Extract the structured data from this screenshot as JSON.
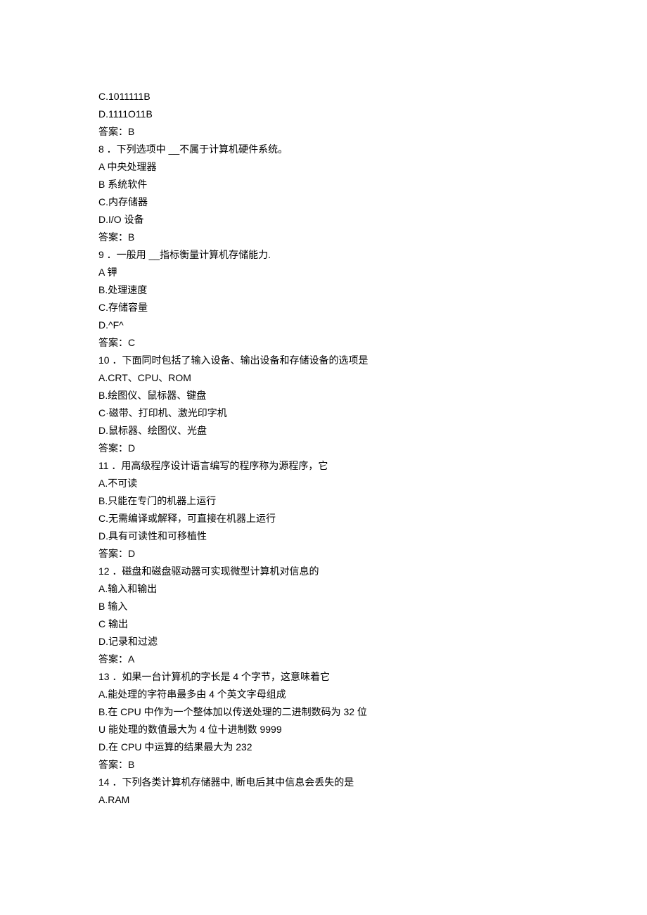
{
  "lines": [
    "C.1011111B",
    "D.1111O11B",
    "答案：B",
    "8 ．下列选项中 __不属于计算机硬件系统。",
    "A 中央处理器",
    "B 系统软件",
    "C.内存储器",
    "D.I/O 设备",
    "答案：B",
    "9 ．一般用 __指标衡量计算机存储能力.",
    "A 钾",
    "B.处理速度",
    "C.存储容量",
    "D.^F^",
    "答案：C",
    "10 ．下面同时包括了输入设备、输出设备和存储设备的选项是",
    "A.CRT、CPU、ROM",
    "B.绘图仪、鼠标器、键盘",
    "C·磁带、打印机、激光印字机",
    "D.鼠标器、绘图仪、光盘",
    "答案：D",
    "11 ．用高级程序设计语言编写的程序称为源程序，它",
    "A.不可读",
    "B.只能在专门的机器上运行",
    "C.无需编译或解释，可直接在机器上运行",
    "D.具有可读性和可移植性",
    "答案：D",
    "12 ．磁盘和磁盘驱动器可实现微型计算机对信息的",
    "A.输入和输出",
    "B 输入",
    "C 输出",
    "D.记录和过滤",
    "答案：A",
    "13 ．如果一台计算机的字长是 4 个字节，这意味着它",
    "A.能处理的字符串最多由 4 个英文字母组成",
    "B.在 CPU 中作为一个整体加以传送处理的二进制数码为 32 位",
    "U 能处理的数值最大为 4 位十进制数 9999",
    "D.在 CPU 中运算的结果最大为 232",
    "答案：B",
    "14 ．下列各类计算机存储器中, 断电后其中信息会丢失的是",
    "A.RAM"
  ]
}
